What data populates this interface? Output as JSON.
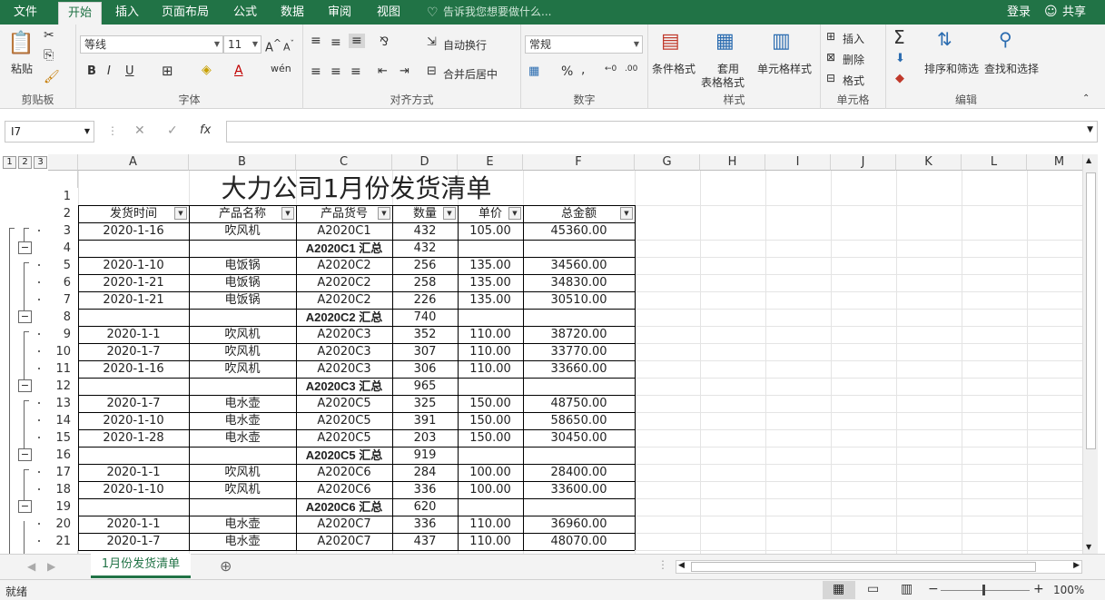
{
  "tabs": {
    "file": "文件",
    "home": "开始",
    "insert": "插入",
    "layout": "页面布局",
    "formula": "公式",
    "data": "数据",
    "review": "审阅",
    "view": "视图",
    "tellme": "告诉我您想要做什么...",
    "login": "登录",
    "share": "共享"
  },
  "ribbon": {
    "paste": "粘贴",
    "clipboard": "剪贴板",
    "font_name": "等线",
    "font_size": "11",
    "font": "字体",
    "wrap": "自动换行",
    "merge": "合并后居中",
    "align": "对齐方式",
    "num_format": "常规",
    "number": "数字",
    "cond": "条件格式",
    "table_l1": "套用",
    "table_l2": "表格格式",
    "cellstyle": "单元格样式",
    "styles": "样式",
    "ins": "插入",
    "del": "删除",
    "fmt": "格式",
    "cells": "单元格",
    "sort": "排序和筛选",
    "find": "查找和选择",
    "edit": "编辑"
  },
  "namebox": "I7",
  "columns": [
    "A",
    "B",
    "C",
    "D",
    "E",
    "F",
    "G",
    "H",
    "I",
    "J",
    "K",
    "L",
    "M"
  ],
  "outline_levels": [
    "1",
    "2",
    "3"
  ],
  "title": "大力公司1月份发货清单",
  "headers": [
    "发货时间",
    "产品名称",
    "产品货号",
    "数量",
    "单价",
    "总金额"
  ],
  "rows": [
    {
      "n": "3",
      "a": "2020-1-16",
      "b": "吹风机",
      "c": "A2020C1",
      "d": "432",
      "e": "105.00",
      "f": "45360.00"
    },
    {
      "n": "4",
      "a": "",
      "b": "",
      "c": "A2020C1 汇总",
      "d": "432",
      "e": "",
      "f": "",
      "sub": true
    },
    {
      "n": "5",
      "a": "2020-1-10",
      "b": "电饭锅",
      "c": "A2020C2",
      "d": "256",
      "e": "135.00",
      "f": "34560.00"
    },
    {
      "n": "6",
      "a": "2020-1-21",
      "b": "电饭锅",
      "c": "A2020C2",
      "d": "258",
      "e": "135.00",
      "f": "34830.00"
    },
    {
      "n": "7",
      "a": "2020-1-21",
      "b": "电饭锅",
      "c": "A2020C2",
      "d": "226",
      "e": "135.00",
      "f": "30510.00"
    },
    {
      "n": "8",
      "a": "",
      "b": "",
      "c": "A2020C2 汇总",
      "d": "740",
      "e": "",
      "f": "",
      "sub": true
    },
    {
      "n": "9",
      "a": "2020-1-1",
      "b": "吹风机",
      "c": "A2020C3",
      "d": "352",
      "e": "110.00",
      "f": "38720.00"
    },
    {
      "n": "10",
      "a": "2020-1-7",
      "b": "吹风机",
      "c": "A2020C3",
      "d": "307",
      "e": "110.00",
      "f": "33770.00"
    },
    {
      "n": "11",
      "a": "2020-1-16",
      "b": "吹风机",
      "c": "A2020C3",
      "d": "306",
      "e": "110.00",
      "f": "33660.00"
    },
    {
      "n": "12",
      "a": "",
      "b": "",
      "c": "A2020C3 汇总",
      "d": "965",
      "e": "",
      "f": "",
      "sub": true
    },
    {
      "n": "13",
      "a": "2020-1-7",
      "b": "电水壶",
      "c": "A2020C5",
      "d": "325",
      "e": "150.00",
      "f": "48750.00"
    },
    {
      "n": "14",
      "a": "2020-1-10",
      "b": "电水壶",
      "c": "A2020C5",
      "d": "391",
      "e": "150.00",
      "f": "58650.00"
    },
    {
      "n": "15",
      "a": "2020-1-28",
      "b": "电水壶",
      "c": "A2020C5",
      "d": "203",
      "e": "150.00",
      "f": "30450.00"
    },
    {
      "n": "16",
      "a": "",
      "b": "",
      "c": "A2020C5 汇总",
      "d": "919",
      "e": "",
      "f": "",
      "sub": true
    },
    {
      "n": "17",
      "a": "2020-1-1",
      "b": "吹风机",
      "c": "A2020C6",
      "d": "284",
      "e": "100.00",
      "f": "28400.00"
    },
    {
      "n": "18",
      "a": "2020-1-10",
      "b": "吹风机",
      "c": "A2020C6",
      "d": "336",
      "e": "100.00",
      "f": "33600.00"
    },
    {
      "n": "19",
      "a": "",
      "b": "",
      "c": "A2020C6 汇总",
      "d": "620",
      "e": "",
      "f": "",
      "sub": true
    },
    {
      "n": "20",
      "a": "2020-1-1",
      "b": "电水壶",
      "c": "A2020C7",
      "d": "336",
      "e": "110.00",
      "f": "36960.00"
    },
    {
      "n": "21",
      "a": "2020-1-7",
      "b": "电水壶",
      "c": "A2020C7",
      "d": "437",
      "e": "110.00",
      "f": "48070.00"
    }
  ],
  "sheet_tab": "1月份发货清单",
  "status": "就绪",
  "zoom": "100%",
  "accent": "#217346"
}
